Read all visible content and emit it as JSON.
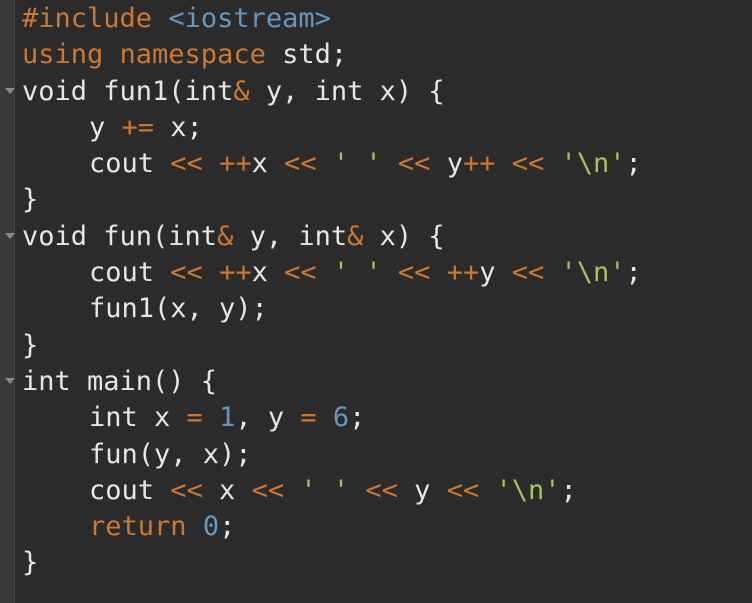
{
  "editor": {
    "lines": [
      {
        "parts": [
          {
            "t": "#include",
            "c": "kw"
          },
          {
            "t": " ",
            "c": "pl"
          },
          {
            "t": "<iostream>",
            "c": "num"
          }
        ]
      },
      {
        "parts": [
          {
            "t": "using namespace",
            "c": "kw"
          },
          {
            "t": " std;",
            "c": "pl"
          }
        ]
      },
      {
        "fold": true,
        "parts": [
          {
            "t": "void fun1(int",
            "c": "pl"
          },
          {
            "t": "&",
            "c": "op"
          },
          {
            "t": " y, int x) {",
            "c": "pl"
          }
        ]
      },
      {
        "indent": true,
        "parts": [
          {
            "t": "y ",
            "c": "pl"
          },
          {
            "t": "+=",
            "c": "op"
          },
          {
            "t": " x;",
            "c": "pl"
          }
        ]
      },
      {
        "indent": true,
        "parts": [
          {
            "t": "cout ",
            "c": "pl"
          },
          {
            "t": "<<",
            "c": "op"
          },
          {
            "t": " ",
            "c": "pl"
          },
          {
            "t": "++",
            "c": "op"
          },
          {
            "t": "x ",
            "c": "pl"
          },
          {
            "t": "<<",
            "c": "op"
          },
          {
            "t": " ",
            "c": "pl"
          },
          {
            "t": "' '",
            "c": "str"
          },
          {
            "t": " ",
            "c": "pl"
          },
          {
            "t": "<<",
            "c": "op"
          },
          {
            "t": " y",
            "c": "pl"
          },
          {
            "t": "++",
            "c": "op"
          },
          {
            "t": " ",
            "c": "pl"
          },
          {
            "t": "<<",
            "c": "op"
          },
          {
            "t": " ",
            "c": "pl"
          },
          {
            "t": "'\\n'",
            "c": "str"
          },
          {
            "t": ";",
            "c": "pl"
          }
        ]
      },
      {
        "parts": [
          {
            "t": "}",
            "c": "pl"
          }
        ]
      },
      {
        "fold": true,
        "parts": [
          {
            "t": "void fun(int",
            "c": "pl"
          },
          {
            "t": "&",
            "c": "op"
          },
          {
            "t": " y, int",
            "c": "pl"
          },
          {
            "t": "&",
            "c": "op"
          },
          {
            "t": " x) {",
            "c": "pl"
          }
        ]
      },
      {
        "indent": true,
        "parts": [
          {
            "t": "cout ",
            "c": "pl"
          },
          {
            "t": "<<",
            "c": "op"
          },
          {
            "t": " ",
            "c": "pl"
          },
          {
            "t": "++",
            "c": "op"
          },
          {
            "t": "x ",
            "c": "pl"
          },
          {
            "t": "<<",
            "c": "op"
          },
          {
            "t": " ",
            "c": "pl"
          },
          {
            "t": "' '",
            "c": "str"
          },
          {
            "t": " ",
            "c": "pl"
          },
          {
            "t": "<<",
            "c": "op"
          },
          {
            "t": " ",
            "c": "pl"
          },
          {
            "t": "++",
            "c": "op"
          },
          {
            "t": "y ",
            "c": "pl"
          },
          {
            "t": "<<",
            "c": "op"
          },
          {
            "t": " ",
            "c": "pl"
          },
          {
            "t": "'\\n'",
            "c": "str"
          },
          {
            "t": ";",
            "c": "pl"
          }
        ]
      },
      {
        "indent": true,
        "parts": [
          {
            "t": "fun1(x, y);",
            "c": "pl"
          }
        ]
      },
      {
        "parts": [
          {
            "t": "}",
            "c": "pl"
          }
        ]
      },
      {
        "fold": true,
        "parts": [
          {
            "t": "int main() {",
            "c": "pl"
          }
        ]
      },
      {
        "indent": true,
        "parts": [
          {
            "t": "int x ",
            "c": "pl"
          },
          {
            "t": "=",
            "c": "op"
          },
          {
            "t": " ",
            "c": "pl"
          },
          {
            "t": "1",
            "c": "num"
          },
          {
            "t": ", y ",
            "c": "pl"
          },
          {
            "t": "=",
            "c": "op"
          },
          {
            "t": " ",
            "c": "pl"
          },
          {
            "t": "6",
            "c": "num"
          },
          {
            "t": ";",
            "c": "pl"
          }
        ]
      },
      {
        "indent": true,
        "parts": [
          {
            "t": "fun(y, x);",
            "c": "pl"
          }
        ]
      },
      {
        "indent": true,
        "parts": [
          {
            "t": "cout ",
            "c": "pl"
          },
          {
            "t": "<<",
            "c": "op"
          },
          {
            "t": " x ",
            "c": "pl"
          },
          {
            "t": "<<",
            "c": "op"
          },
          {
            "t": " ",
            "c": "pl"
          },
          {
            "t": "' '",
            "c": "str"
          },
          {
            "t": " ",
            "c": "pl"
          },
          {
            "t": "<<",
            "c": "op"
          },
          {
            "t": " y ",
            "c": "pl"
          },
          {
            "t": "<<",
            "c": "op"
          },
          {
            "t": " ",
            "c": "pl"
          },
          {
            "t": "'\\n'",
            "c": "str"
          },
          {
            "t": ";",
            "c": "pl"
          }
        ]
      },
      {
        "indent": true,
        "parts": [
          {
            "t": "return",
            "c": "kw"
          },
          {
            "t": " ",
            "c": "pl"
          },
          {
            "t": "0",
            "c": "num"
          },
          {
            "t": ";",
            "c": "pl"
          }
        ]
      },
      {
        "parts": [
          {
            "t": "}",
            "c": "pl"
          }
        ]
      }
    ]
  }
}
